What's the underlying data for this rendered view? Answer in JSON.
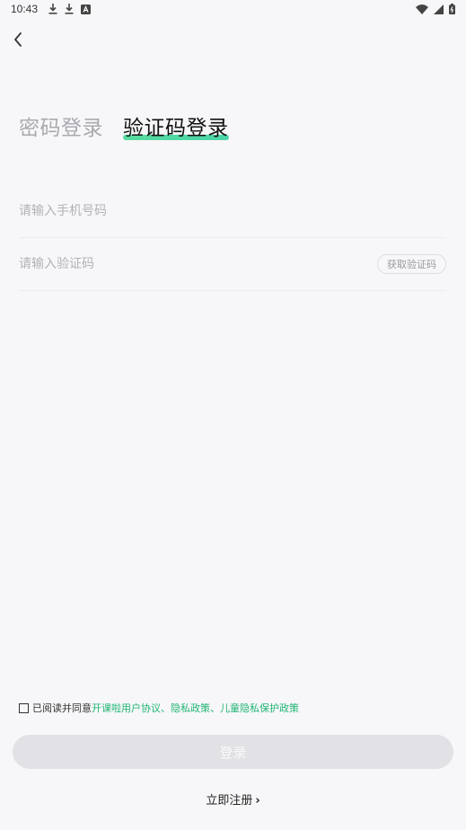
{
  "status_bar": {
    "time": "10:43",
    "left_icons": [
      "download-icon",
      "download-icon",
      "app-a-icon"
    ],
    "right_icons": [
      "wifi-icon",
      "signal-icon",
      "battery-icon"
    ]
  },
  "tabs": {
    "password_login": "密码登录",
    "code_login": "验证码登录",
    "active": "code_login",
    "accent_color": "#2fd291"
  },
  "form": {
    "phone_placeholder": "请输入手机号码",
    "phone_value": "",
    "code_placeholder": "请输入验证码",
    "code_value": "",
    "get_code_label": "获取验证码"
  },
  "agreement": {
    "prefix": "已阅读并同意",
    "link_user": "开课啦用户协议",
    "sep1": "、",
    "link_privacy": "隐私政策",
    "sep2": "、",
    "link_child": "儿童隐私保护政策",
    "checked": false,
    "link_color": "#22b573"
  },
  "actions": {
    "login_label": "登录",
    "register_label": "立即注册"
  }
}
